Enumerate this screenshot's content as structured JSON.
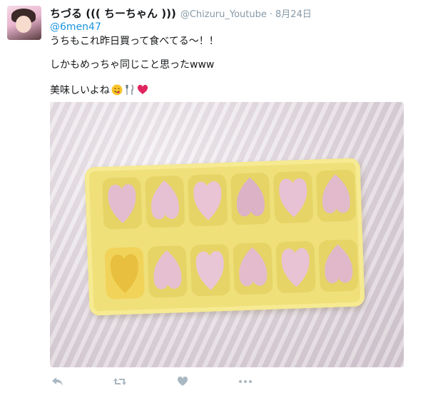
{
  "tweet": {
    "display_name": "ちづる ((( ちーちゃん )))",
    "handle": "@Chizuru_Youtube",
    "separator": "·",
    "date": "8月24日",
    "reply_to": "@6men47",
    "text_line1": "うちもこれ昨日買って食べてる〜！！",
    "text_line2": "しかもめっちゃ同じこと思ったwww",
    "text_line3": "美味しいよね",
    "emojis": [
      "savoring-food-face-icon",
      "fork-knife-icon",
      "red-heart-icon"
    ]
  },
  "actions": [
    "reply-icon",
    "retweet-icon",
    "like-icon",
    "more-icon"
  ],
  "colors": {
    "name": "#14171a",
    "muted": "#8899a6",
    "link": "#1b95e0",
    "heart": "#e0245e"
  }
}
